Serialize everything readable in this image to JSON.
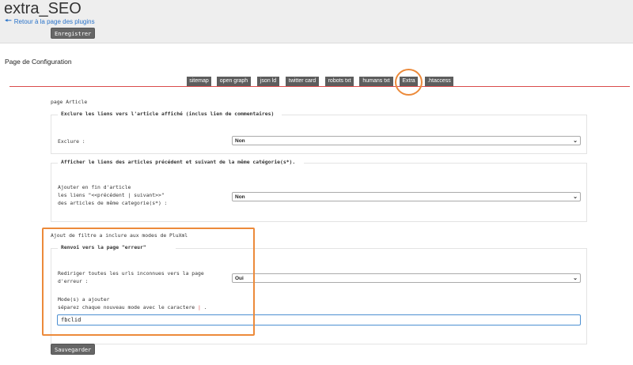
{
  "header": {
    "title": "extra_SEO",
    "back_link": "Retour à la page des plugins",
    "save_button": "Enregistrer"
  },
  "config_title": "Page de Configuration",
  "tabs": [
    {
      "label": "sitemap"
    },
    {
      "label": "open graph"
    },
    {
      "label": "json ld"
    },
    {
      "label": "twitter card"
    },
    {
      "label": "robots txt"
    },
    {
      "label": "humans txt"
    },
    {
      "label": "Extra"
    },
    {
      "label": ".htaccess"
    }
  ],
  "active_tab": "Extra",
  "section_article": {
    "heading": "page Article",
    "fs1": {
      "legend": "Exclure les liens vers l'article affiché (inclus lien de commentaires)",
      "label": "Exclure :",
      "value": "Non"
    },
    "fs2": {
      "legend": "Afficher le liens des articles précédent et suivant de la même catégorie(s*).",
      "label_line1": "Ajouter en fin d'article",
      "label_line2": "les liens \"<<précédent | suivant>>\"",
      "label_line3": "des articles de même categorie(s*) :",
      "value": "Non"
    }
  },
  "section_filter": {
    "heading": "Ajout de filtre a inclure aux modes de PluXml",
    "fs3": {
      "legend": "Renvoi vers la page \"erreur\"",
      "label_line1": "Rediriger toutes les urls inconnues vers la page",
      "label_line2": "d'erreur :",
      "value": "Oui",
      "mode_label": "Mode(s) a ajouter",
      "separator_text": "séparez chaque nouveau mode avec le caractere",
      "separator_char": "|",
      "separator_end": ".",
      "mode_value": "fbclid"
    }
  },
  "save_bottom": "Sauvegarder",
  "colors": {
    "accent_link": "#2a73c9",
    "tab_bg": "#5d5d5d",
    "red_line": "#d94b4b",
    "highlight": "#ec8a3a",
    "input_focus": "#4c8fd1"
  },
  "icons": {
    "back": "arrow-left-icon",
    "select": "chevron-down-icon"
  }
}
